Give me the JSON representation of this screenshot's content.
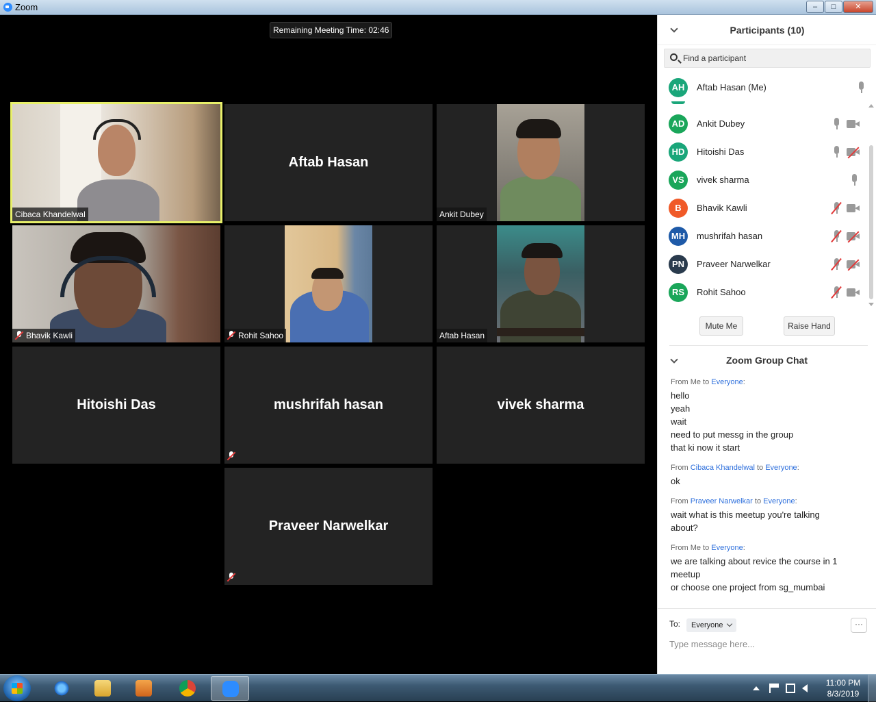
{
  "window": {
    "title": "Zoom",
    "min": "–",
    "max": "□",
    "close": "✕"
  },
  "meeting": {
    "remaining_time": "Remaining Meeting Time: 02:46"
  },
  "tiles": [
    {
      "name": "Cibaca Khandelwal",
      "video": true,
      "active": true,
      "muted": false
    },
    {
      "name": "Aftab Hasan",
      "video": false,
      "muted": false
    },
    {
      "name": "Ankit Dubey",
      "video": true,
      "muted": false
    },
    {
      "name": "Bhavik Kawli",
      "video": true,
      "muted": true
    },
    {
      "name": "Rohit Sahoo",
      "video": true,
      "muted": true
    },
    {
      "name": "Aftab Hasan",
      "video": true,
      "muted": false
    },
    {
      "name": "Hitoishi Das",
      "video": false,
      "muted": false
    },
    {
      "name": "mushrifah hasan",
      "video": false,
      "muted": true
    },
    {
      "name": "vivek sharma",
      "video": false,
      "muted": false
    },
    {
      "name": "Praveer Narwelkar",
      "video": false,
      "muted": true
    }
  ],
  "participants": {
    "title": "Participants (10)",
    "search_placeholder": "Find a participant",
    "list": [
      {
        "initials": "AH",
        "name": "Aftab Hasan (Me)",
        "color": "#1aa67a",
        "mic": "on",
        "cam": "none"
      },
      {
        "initials": "AD",
        "name": "Ankit Dubey",
        "color": "#1aa65a",
        "mic": "on",
        "cam": "on"
      },
      {
        "initials": "HD",
        "name": "Hitoishi Das",
        "color": "#1aa67a",
        "mic": "on",
        "cam": "off"
      },
      {
        "initials": "VS",
        "name": "vivek sharma",
        "color": "#1aa65a",
        "mic": "on",
        "cam": "none"
      },
      {
        "initials": "B",
        "name": "Bhavik Kawli",
        "color": "#f05a28",
        "mic": "off",
        "cam": "on"
      },
      {
        "initials": "MH",
        "name": "mushrifah hasan",
        "color": "#1e5aa8",
        "mic": "off",
        "cam": "off"
      },
      {
        "initials": "PN",
        "name": "Praveer Narwelkar",
        "color": "#2a3b4d",
        "mic": "off",
        "cam": "off"
      },
      {
        "initials": "RS",
        "name": "Rohit Sahoo",
        "color": "#1aa65a",
        "mic": "off",
        "cam": "on"
      }
    ],
    "mute_me": "Mute Me",
    "raise_hand": "Raise Hand"
  },
  "chat": {
    "title": "Zoom Group Chat",
    "messages": [
      {
        "from": "Me",
        "to": "Everyone",
        "from_label": "From Me to ",
        "from_link": "",
        "to_label": "",
        "lines": [
          "hello",
          "yeah",
          "wait",
          "need to put messg in the group",
          "that ki now it start"
        ]
      },
      {
        "from_label": "From ",
        "from_link": "Cibaca Khandelwal",
        "to_label": " to ",
        "to": "Everyone",
        "lines": [
          "ok"
        ]
      },
      {
        "from_label": "From ",
        "from_link": "Praveer Narwelkar",
        "to_label": " to ",
        "to": "Everyone",
        "lines": [
          "wait what is this meetup you're talking",
          "about?"
        ]
      },
      {
        "from_label": "From Me to ",
        "from_link": "",
        "to_label": "",
        "to": "Everyone",
        "lines": [
          "we are talking about revice the course in 1",
          "meetup",
          "or choose one project from sg_mumbai"
        ]
      }
    ],
    "to_label": "To:",
    "to_value": "Everyone",
    "more": "···",
    "input_placeholder": "Type message here..."
  },
  "taskbar": {
    "time": "11:00 PM",
    "date": "8/3/2019",
    "apps": [
      "internet-explorer",
      "file-explorer",
      "media-player",
      "chrome",
      "zoom"
    ]
  },
  "colors": {
    "active_speaker": "#e8f06a",
    "link_blue": "#2d6fdc",
    "tile_bg": "#232323"
  }
}
